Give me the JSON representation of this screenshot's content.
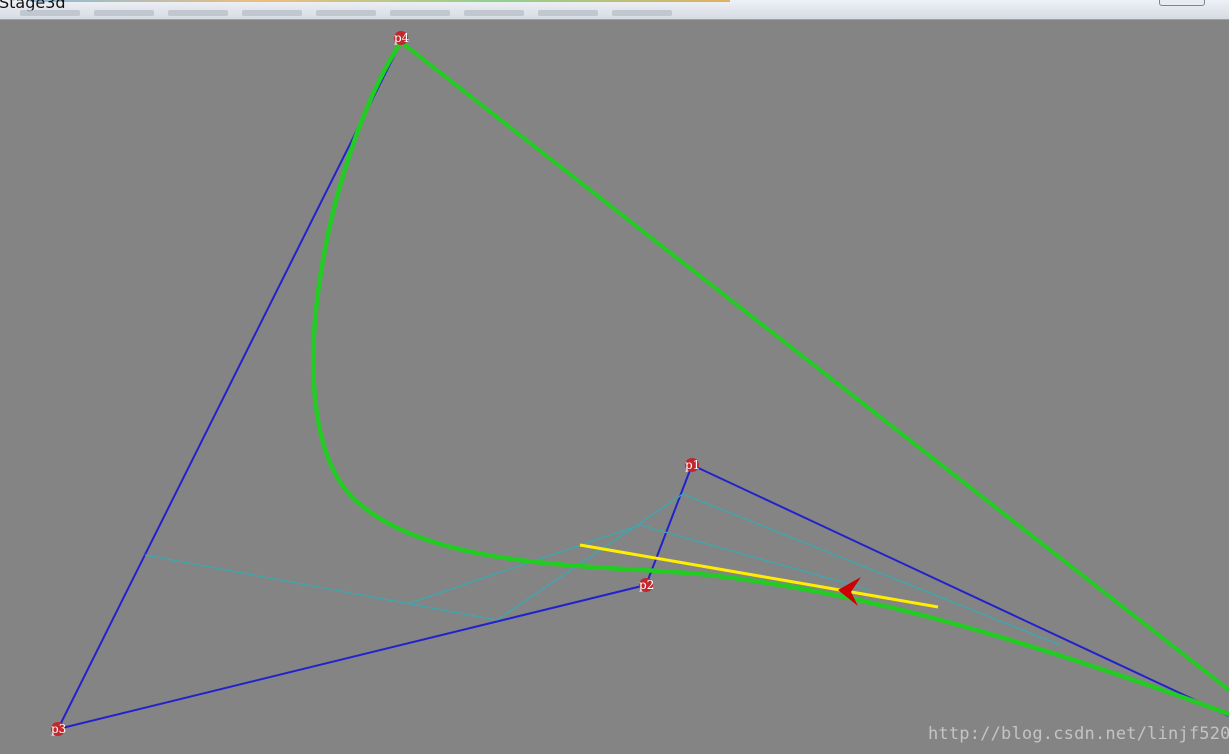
{
  "window": {
    "title": "Stage3d"
  },
  "points": {
    "p1": "p1",
    "p2": "p2",
    "p3": "p3",
    "p4": "p4"
  },
  "watermark": "http://blog.csdn.net/linjf520",
  "colors": {
    "background": "#848484",
    "control_lines": "#2222cc",
    "curve": "#22cc22",
    "construction": "#3aa9b0",
    "tangent": "#ffee00",
    "arrow": "#cc0000",
    "point_marker": "#c0282e"
  }
}
